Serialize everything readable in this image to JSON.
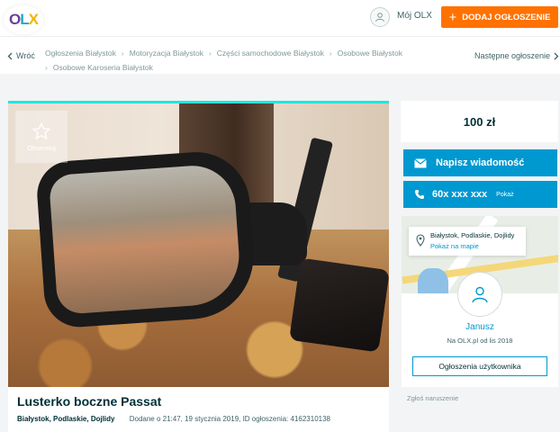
{
  "header": {
    "logo_letters": [
      "O",
      "L",
      "X"
    ],
    "my_olx": "Mój OLX",
    "add_listing": "DODAJ OGŁOSZENIE",
    "add_icon": "+"
  },
  "breadcrumbs": {
    "back": "Wróć",
    "items": [
      "Ogłoszenia Białystok",
      "Motoryzacja Białystok",
      "Części samochodowe Białystok",
      "Osobowe Białystok",
      "Osobowe Karoseria Białystok"
    ],
    "next": "Następne ogłoszenie"
  },
  "photo": {
    "observe_label": "Obserwuj"
  },
  "listing": {
    "title": "Lusterko boczne Passat",
    "location": "Białystok, Podlaskie, Dojlidy",
    "added": "Dodane o 21:47, 19 stycznia 2019, ID ogłoszenia: 4162310138"
  },
  "sidebar": {
    "price": "100 zł",
    "message_button": "Napisz wiadomość",
    "phone_masked": "60x xxx xxx",
    "phone_show": "Pokaż",
    "map_address": "Białystok, Podlaskie, Dojlidy",
    "map_link": "Pokaż na mapie",
    "user_name": "Janusz",
    "user_since": "Na OLX.pl od lis 2018",
    "user_ads_button": "Ogłoszenia użytkownika",
    "report": "Zgłoś naruszenie"
  },
  "colors": {
    "accent_orange": "#ff7200",
    "primary_blue": "#0098d0",
    "text_dark": "#002f34",
    "photo_top_border": "#23e5db"
  }
}
